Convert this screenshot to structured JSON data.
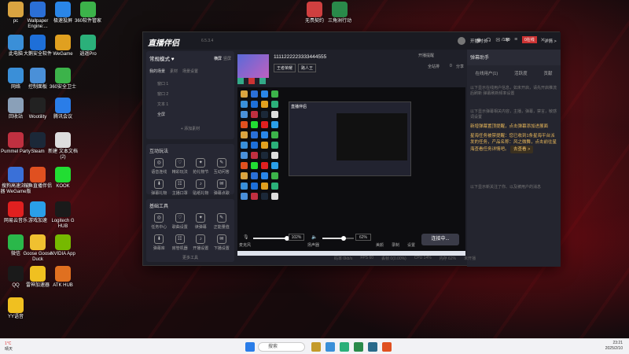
{
  "desktop": {
    "icons": [
      {
        "label": "pc",
        "color": "#d9a441"
      },
      {
        "label": "Wallpaper Engine:...",
        "color": "#2b6fd6"
      },
      {
        "label": "极速投屏",
        "color": "#2a86e8"
      },
      {
        "label": "360软件管家",
        "color": "#3cb34a"
      },
      {
        "label": "此电脑",
        "color": "#3a8fd8"
      },
      {
        "label": "大鹅安全软件",
        "color": "#1e6fd8"
      },
      {
        "label": "WeGame",
        "color": "#e0a020"
      },
      {
        "label": "逍遥Pro",
        "color": "#2bb07a"
      },
      {
        "label": "网络",
        "color": "#3a8fd8"
      },
      {
        "label": "控制面板",
        "color": "#4a90d8"
      },
      {
        "label": "360安全卫士",
        "color": "#3cb34a"
      },
      {
        "label": "回收站",
        "color": "#8aa0b8"
      },
      {
        "label": "Wootility",
        "color": "#222"
      },
      {
        "label": "腾讯会议",
        "color": "#2a7de8"
      },
      {
        "label": "Pummel Party",
        "color": "#c03040"
      },
      {
        "label": "Steam",
        "color": "#1b2838"
      },
      {
        "label": "新建 文本文档 (2)",
        "color": "#ddd"
      },
      {
        "label": "搜狗高速浏览器 WeGame版",
        "color": "#3a70d8"
      },
      {
        "label": "斗鱼直播伴侣",
        "color": "#e05020"
      },
      {
        "label": "KOOK",
        "color": "#2d3"
      },
      {
        "label": "网易云音乐",
        "color": "#e02020"
      },
      {
        "label": "游戏加速",
        "color": "#2a9fe8"
      },
      {
        "label": "Logitech G HUB",
        "color": "#1a1a1a"
      },
      {
        "label": "微信",
        "color": "#2ab84a"
      },
      {
        "label": "Goose Goose Duck",
        "color": "#f0c030"
      },
      {
        "label": "NVIDIA App",
        "color": "#76b900"
      },
      {
        "label": "QQ",
        "color": "#1a1a1a"
      },
      {
        "label": "雷神加速器",
        "color": "#f0c020"
      },
      {
        "label": "ATK HUB",
        "color": "#e07020"
      },
      {
        "label": "YY语音",
        "color": "#f0c020"
      },
      {
        "label": "无畏契约",
        "color": "#d04040"
      },
      {
        "label": "三角洲行动",
        "color": "#2a8a4a"
      }
    ]
  },
  "app": {
    "title": "直播伴侣",
    "version": "6.5.3.4",
    "stream_title": "1111222223333444555",
    "stream_tags": [
      "王者荣耀",
      "路人王"
    ],
    "open_live": "开播提醒",
    "fans": "全站排",
    "likes": "0",
    "share": "分享",
    "scene_title": "常规模式 ♥",
    "scene_tabs": [
      "横屏",
      "竖屏"
    ],
    "scene_sub": [
      "我的场景",
      "素材",
      "场景设置"
    ],
    "scenes": [
      "窗口 1",
      "窗口 2",
      "文本 1",
      "全屏"
    ],
    "add_material": "+ 添加素材",
    "interact_title": "互动玩法",
    "interact_items": [
      "语音连线",
      "精彩玩法",
      "抢礼物节",
      "互动问答",
      "弹幕礼物",
      "主播口罩",
      "贴纸礼物",
      "弹幕点歌"
    ],
    "tools_title": "基础工具",
    "tools_items": [
      "任务中心",
      "歌曲设置",
      "读弹幕",
      "正能量值",
      "弹幕库",
      "房管机器",
      "开播设置",
      "下播设置"
    ],
    "more_tools": "更多工具",
    "mic_label": "麦克风",
    "mic_pct": "102%",
    "speaker_label": "扬声器",
    "speaker_pct": "62%",
    "effects": "美颜",
    "record": "录制",
    "settings": "设置",
    "live_button": "连接中...",
    "status": {
      "bitrate": "码率 0kb/s",
      "fps": "FPS 60",
      "dropped": "丢帧 0(0.00%)",
      "cpu": "CPU 14%",
      "mem": "内存 62%",
      "state": "未开播"
    },
    "header_right": {
      "live_item": "开播时长",
      "count": "/120",
      "online": "0在线",
      "detail": "详情 >"
    },
    "assistant": {
      "title": "弹幕助手",
      "tabs": [
        "在线用户(1)",
        "活跃度",
        "贡献"
      ],
      "notice1": "以下显示在线用户信息，如未开启，请先开启推流后刷新 弹幕刷新频率设置",
      "notice2": "以下显示弹幕相关内容，主播，弹幕，禁言，敏感词设置",
      "hint": "新增弹幕置顶提醒，点击弹幕添加进展面",
      "task_text": "星海任务被禁提醒：您已收到1条星海平台派发的任务，产品名称：风之微舞，点击前往星海查看任务详情吧。",
      "task_link": "去查看 >",
      "bottom_notice": "以下显示新关注了你、以及被用户的消息"
    },
    "inner_logo": "直播伴侣"
  },
  "taskbar": {
    "weather_temp": "1°C",
    "weather_text": "晴天",
    "search_placeholder": "搜索",
    "time": "23:21",
    "date": "2025/2/10"
  }
}
